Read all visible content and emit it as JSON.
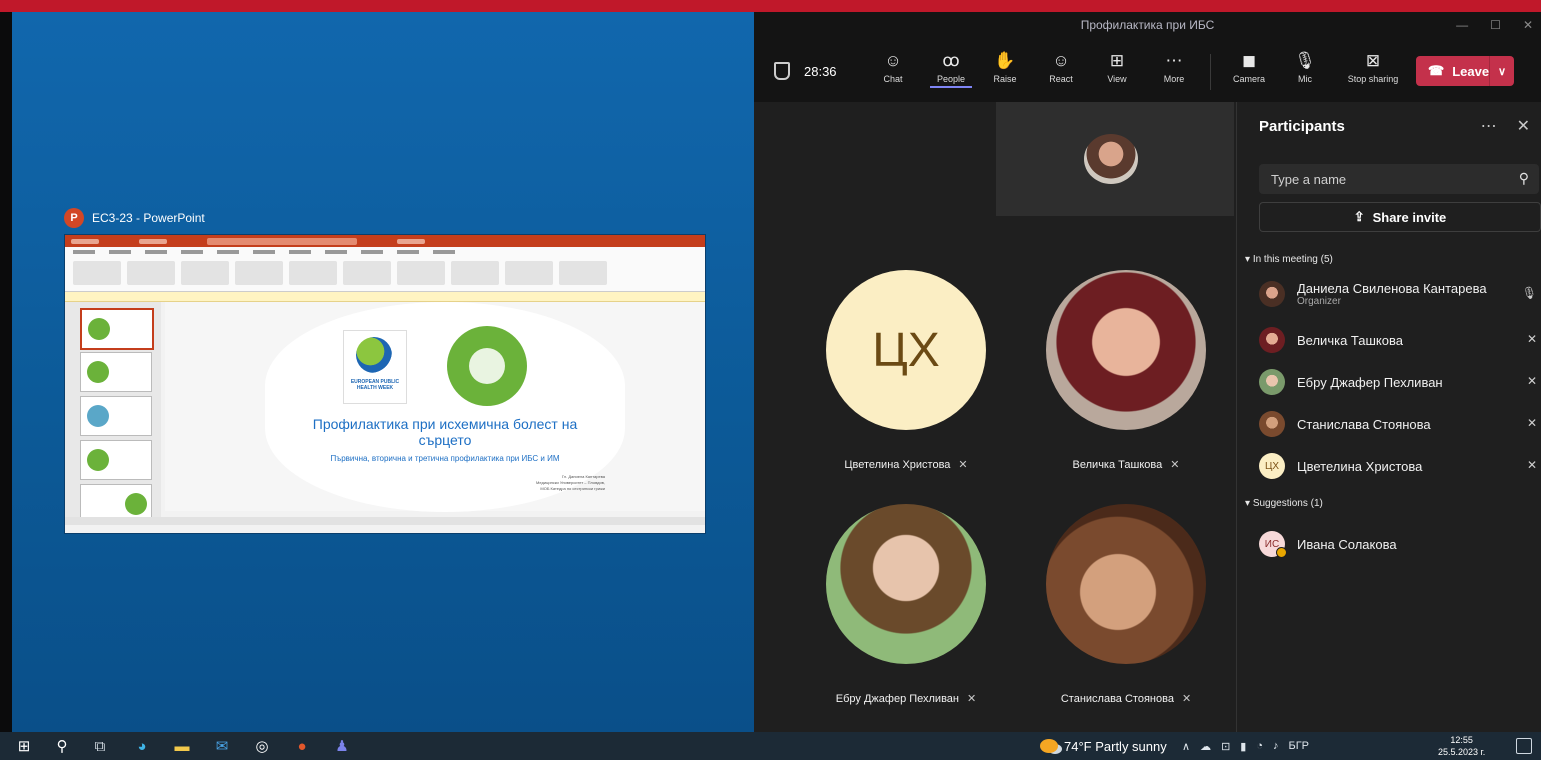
{
  "powerpoint": {
    "window_label": "EC3-23 - PowerPoint",
    "logo_letter": "P",
    "slide_title": "Профилактика при исхемична болест на сърцето",
    "slide_subtitle": "Първична, вторична и третична профилактика при ИБС и ИМ",
    "eph_logo_text": "EUROPEAN PUBLIC HEALTH WEEK",
    "author_lines": [
      "Гл. Даниела Кантарева",
      "Медицински Университет – Пловдив,",
      "МОБ Катедра по сестрински грижи"
    ]
  },
  "teams": {
    "window_title": "Профилактика при ИБС",
    "timer": "28:36",
    "toolbar": {
      "chat": "Chat",
      "people": "People",
      "raise": "Raise",
      "react": "React",
      "view": "View",
      "more": "More",
      "camera": "Camera",
      "mic": "Mic",
      "stop_sharing": "Stop sharing",
      "leave": "Leave"
    },
    "icons": {
      "chat": "☺",
      "people": "ꝏ",
      "raise": "✋",
      "react": "☺",
      "view": "⊞",
      "more": "⋯",
      "camera": "◼",
      "mic": "🎙",
      "stop_sharing": "⊠",
      "leave": "☎",
      "chevron": "∨",
      "mic_off": "✕",
      "search": "⚲",
      "share": "⇪",
      "close": "✕",
      "ellipsis": "⋯",
      "minimize": "—",
      "maximize": "☐",
      "window_close": "✕"
    },
    "tiles": [
      {
        "initials": "ЦХ",
        "name": "Цветелина Христова"
      },
      {
        "name": "Величка Ташкова"
      },
      {
        "name": "Ебру Джафер Пехливан"
      },
      {
        "name": "Станислава Стоянова"
      }
    ],
    "participants_panel": {
      "title": "Participants",
      "search_placeholder": "Type a name",
      "share_invite": "Share invite",
      "in_meeting_label": "In this meeting (5)",
      "suggestions_label": "Suggestions (1)",
      "in_meeting": [
        {
          "name": "Даниела Свиленова Кантарева",
          "role": "Organizer"
        },
        {
          "name": "Величка Ташкова"
        },
        {
          "name": "Ебру Джафер Пехливан"
        },
        {
          "name": "Станислава Стоянова"
        },
        {
          "name": "Цветелина Христова",
          "initials": "ЦХ"
        }
      ],
      "suggestions": [
        {
          "name": "Ивана Солакова",
          "initials": "ИС"
        }
      ]
    }
  },
  "taskbar": {
    "weather": "74°F  Partly sunny",
    "language": "БГР",
    "time": "12:55",
    "date": "25.5.2023 г."
  }
}
